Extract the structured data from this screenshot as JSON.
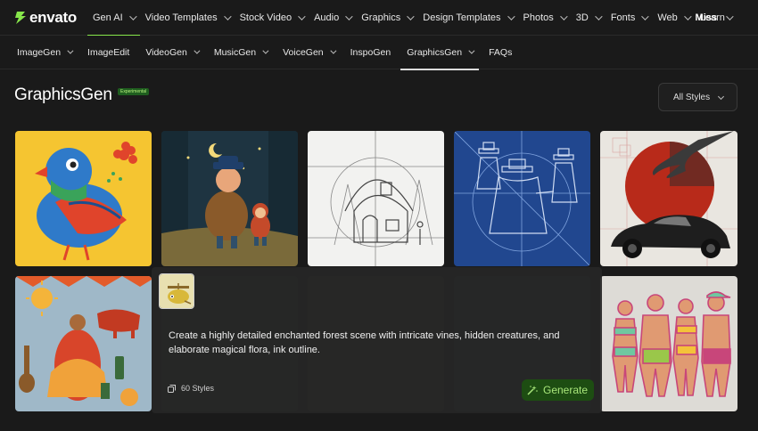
{
  "brand": {
    "name": "envato",
    "accent": "#87e64b"
  },
  "topnav": {
    "items": [
      {
        "label": "Gen AI",
        "chevron": true,
        "active": true
      },
      {
        "label": "Video Templates",
        "chevron": true
      },
      {
        "label": "Stock Video",
        "chevron": true
      },
      {
        "label": "Audio",
        "chevron": true
      },
      {
        "label": "Graphics",
        "chevron": true
      },
      {
        "label": "Design Templates",
        "chevron": true
      },
      {
        "label": "Photos",
        "chevron": true
      },
      {
        "label": "3D",
        "chevron": true
      },
      {
        "label": "Fonts",
        "chevron": true
      },
      {
        "label": "Web",
        "chevron": true
      },
      {
        "label": "Learn",
        "chevron": false
      }
    ],
    "user": "Miss"
  },
  "subnav": {
    "items": [
      {
        "label": "ImageGen",
        "chevron": true
      },
      {
        "label": "ImageEdit",
        "chevron": false
      },
      {
        "label": "VideoGen",
        "chevron": true
      },
      {
        "label": "MusicGen",
        "chevron": true
      },
      {
        "label": "VoiceGen",
        "chevron": true
      },
      {
        "label": "InspoGen",
        "chevron": false
      },
      {
        "label": "GraphicsGen",
        "chevron": true,
        "active": true
      },
      {
        "label": "FAQs",
        "chevron": false
      }
    ]
  },
  "header": {
    "title": "GraphicsGen",
    "badge": "Experimental",
    "styles_dropdown": "All Styles"
  },
  "prompt": {
    "text": "Create a highly detailed enchanted forest scene with intricate vines, hidden creatures, and elaborate magical flora, ink outline.",
    "styles_count": "60 Styles",
    "generate_label": "Generate"
  },
  "icons": [
    "envato-logo-icon",
    "chevron-down-icon",
    "layers-icon",
    "magic-wand-icon"
  ]
}
